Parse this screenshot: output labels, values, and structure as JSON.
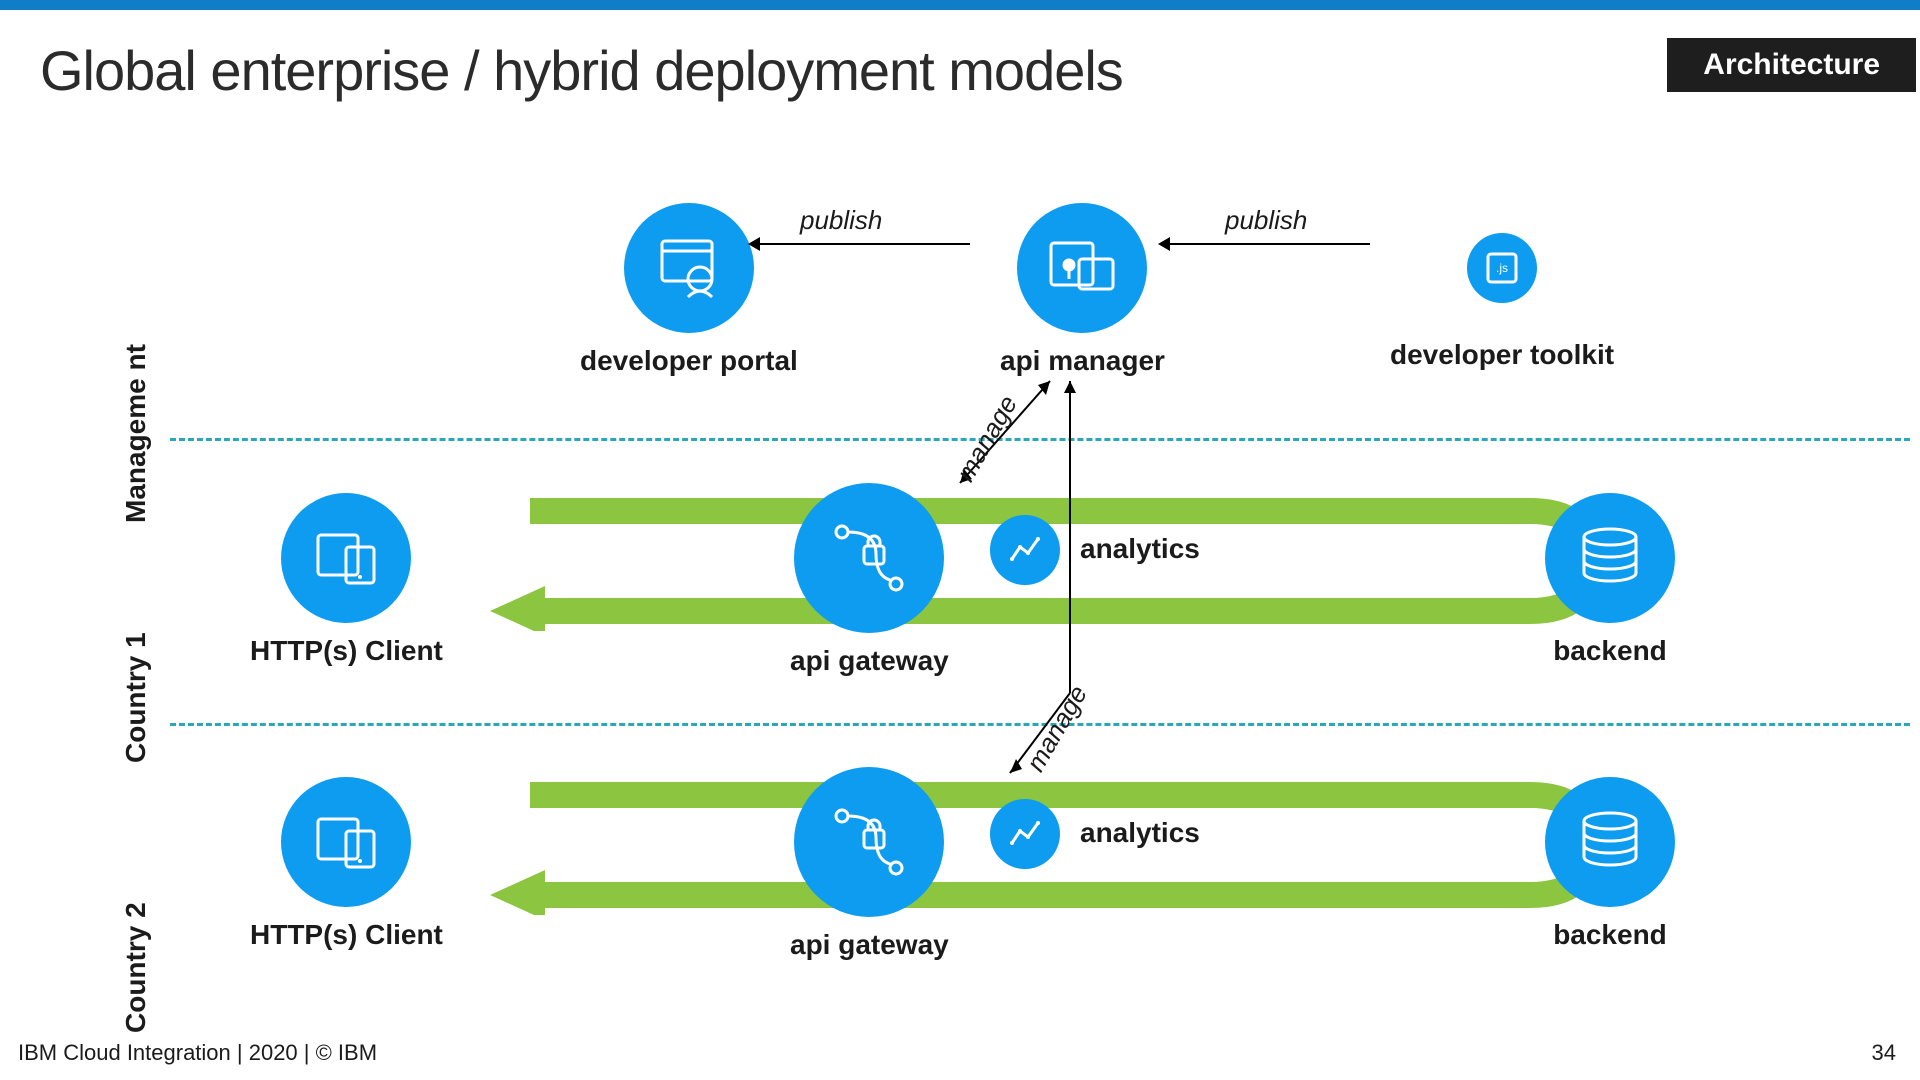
{
  "header": {
    "title": "Global enterprise / hybrid deployment models",
    "badge": "Architecture"
  },
  "sections": {
    "management": "Manageme\nnt",
    "country1": "Country 1",
    "country2": "Country 2"
  },
  "nodes": {
    "portal": "developer portal",
    "manager": "api manager",
    "toolkit": "developer toolkit",
    "client1": "HTTP(s) Client",
    "client2": "HTTP(s) Client",
    "gateway1": "api gateway",
    "gateway2": "api gateway",
    "analytics1": "analytics",
    "analytics2": "analytics",
    "backend1": "backend",
    "backend2": "backend"
  },
  "edges": {
    "publish1": "publish",
    "publish2": "publish",
    "manage1": "manage",
    "manage2": "manage"
  },
  "footer": {
    "left": "IBM Cloud Integration  | 2020 | © IBM",
    "right": "34"
  },
  "colors": {
    "accent": "#0d9cef",
    "flow": "#8cc540",
    "divider": "#2aa7b8",
    "dark": "#1e1e1e"
  }
}
